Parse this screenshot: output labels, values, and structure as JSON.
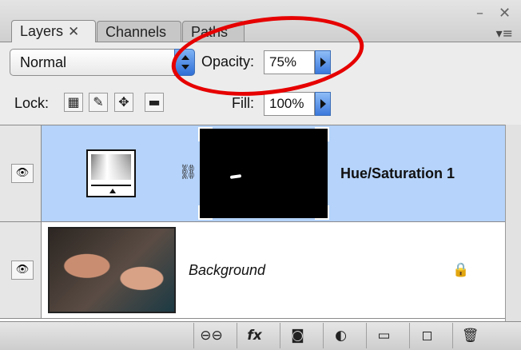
{
  "tabs": [
    {
      "label": "Layers",
      "close": "✕",
      "active": true
    },
    {
      "label": "Channels",
      "active": false
    },
    {
      "label": "Paths",
      "active": false
    }
  ],
  "window": {
    "minimize": "–",
    "close": "✕",
    "menu": "▾≡"
  },
  "blend_mode": {
    "value": "Normal"
  },
  "opacity": {
    "label": "Opacity:",
    "value": "75%"
  },
  "lock": {
    "label": "Lock:"
  },
  "fill": {
    "label": "Fill:",
    "value": "100%"
  },
  "layers": [
    {
      "name": "Hue/Saturation 1",
      "selected": true,
      "type": "adjustment-with-mask"
    },
    {
      "name": "Background",
      "selected": false,
      "type": "photo",
      "locked": true
    }
  ],
  "icons": {
    "eye": "eye-icon",
    "chain": "link-icon",
    "lock": "lock-icon",
    "fx": "fx-icon"
  },
  "bottom_labels": {
    "fx": "fx"
  },
  "colors": {
    "selection": "#b5d3fb",
    "annotation": "#e60000",
    "accent": "#3a78dc"
  }
}
